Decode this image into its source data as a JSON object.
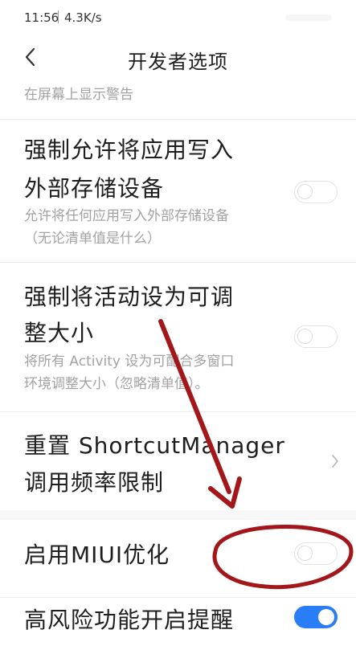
{
  "status_bar": {
    "time": "11:56",
    "net_speed": "4.3K/s"
  },
  "header": {
    "title": "开发者选项",
    "back_icon": "chevron-left-icon"
  },
  "partial_item": {
    "description": "在屏幕上显示警告"
  },
  "settings": [
    {
      "title_lines": [
        "强制允许将应用写入",
        "外部存储设备"
      ],
      "desc_lines": [
        "允许将任何应用写入外部存储设备",
        "（无论清单值是什么）"
      ],
      "control": "toggle",
      "enabled": false
    },
    {
      "title_lines": [
        "强制将活动设为可调",
        "整大小"
      ],
      "desc_lines": [
        "将所有 Activity 设为可配合多窗口",
        "环境调整大小（忽略清单值）。"
      ],
      "control": "toggle",
      "enabled": false
    },
    {
      "title_lines": [
        "重置 ShortcutManager",
        "调用频率限制"
      ],
      "control": "chevron",
      "icon": "chevron-right-icon"
    },
    {
      "title": "启用MIUI优化",
      "control": "toggle",
      "enabled": false
    },
    {
      "title": "高风险功能开启提醒",
      "control": "toggle",
      "enabled": true
    }
  ],
  "colors": {
    "toggle_on": "#2a7ef5",
    "annotation": "#a3171a",
    "secondary_text": "#a2a2a2"
  }
}
